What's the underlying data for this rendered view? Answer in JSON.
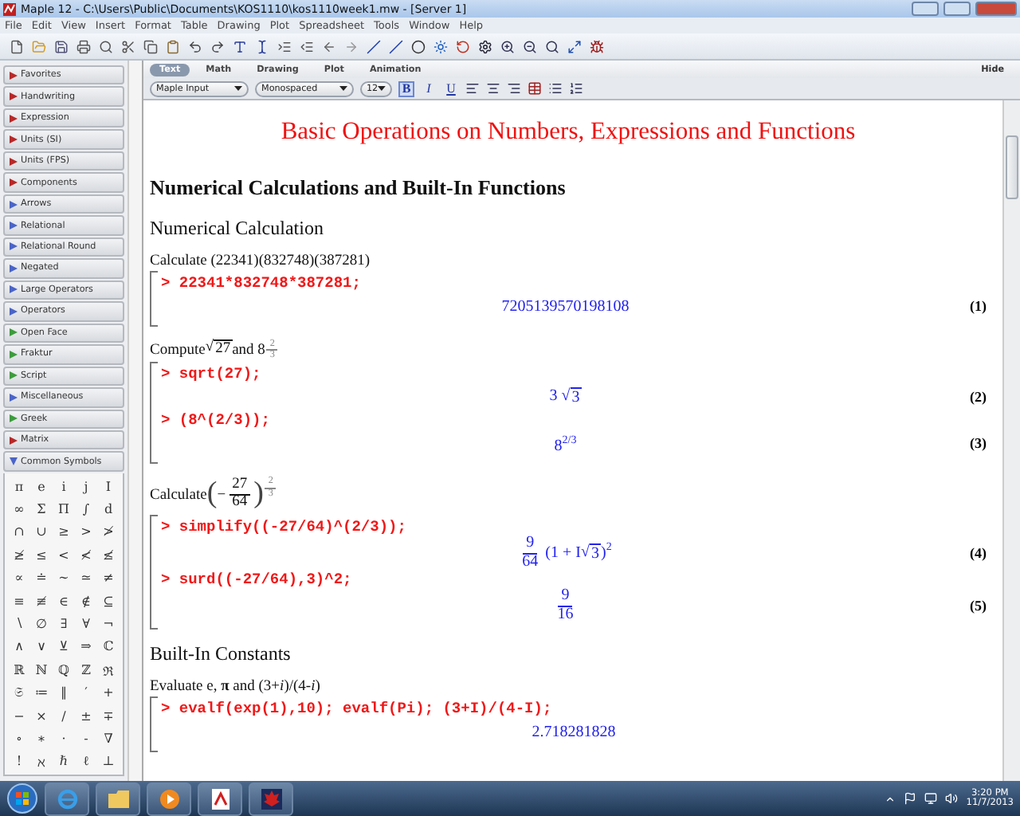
{
  "window": {
    "title": "Maple 12 - C:\\Users\\Public\\Documents\\KOS1110\\kos1110week1.mw - [Server 1]"
  },
  "menu": [
    "File",
    "Edit",
    "View",
    "Insert",
    "Format",
    "Table",
    "Drawing",
    "Plot",
    "Spreadsheet",
    "Tools",
    "Window",
    "Help"
  ],
  "palettes": [
    {
      "label": "Favorites",
      "color": "#b82828",
      "expanded": false
    },
    {
      "label": "Handwriting",
      "color": "#b82828",
      "expanded": false
    },
    {
      "label": "Expression",
      "color": "#b82828",
      "expanded": false
    },
    {
      "label": "Units (SI)",
      "color": "#b82828",
      "expanded": false
    },
    {
      "label": "Units (FPS)",
      "color": "#b82828",
      "expanded": false
    },
    {
      "label": "Components",
      "color": "#b82828",
      "expanded": false
    },
    {
      "label": "Arrows",
      "color": "#4a64c8",
      "expanded": false
    },
    {
      "label": "Relational",
      "color": "#4a64c8",
      "expanded": false
    },
    {
      "label": "Relational Round",
      "color": "#4a64c8",
      "expanded": false
    },
    {
      "label": "Negated",
      "color": "#4a64c8",
      "expanded": false
    },
    {
      "label": "Large Operators",
      "color": "#4a64c8",
      "expanded": false
    },
    {
      "label": "Operators",
      "color": "#4a64c8",
      "expanded": false
    },
    {
      "label": "Open Face",
      "color": "#3c9c3c",
      "expanded": false
    },
    {
      "label": "Fraktur",
      "color": "#3c9c3c",
      "expanded": false
    },
    {
      "label": "Script",
      "color": "#3c9c3c",
      "expanded": false
    },
    {
      "label": "Miscellaneous",
      "color": "#4a64c8",
      "expanded": false
    },
    {
      "label": "Greek",
      "color": "#3c9c3c",
      "expanded": false
    },
    {
      "label": "Matrix",
      "color": "#b82828",
      "expanded": false
    },
    {
      "label": "Common Symbols",
      "color": "#4a64c8",
      "expanded": true,
      "symbols": [
        "π",
        "e",
        "i",
        "j",
        "I",
        "∞",
        "Σ",
        "Π",
        "∫",
        "d",
        "∩",
        "∪",
        "≥",
        ">",
        "≯",
        "≱",
        "≤",
        "<",
        "≮",
        "≰",
        "∝",
        "≐",
        "∼",
        "≃",
        "≠",
        "≡",
        "≢",
        "∈",
        "∉",
        "⊆",
        "∖",
        "∅",
        "∃",
        "∀",
        "¬",
        "∧",
        "∨",
        "⊻",
        "⇒",
        "ℂ",
        "ℝ",
        "ℕ",
        "ℚ",
        "ℤ",
        "ℜ",
        "𝔖",
        "≔",
        "‖",
        "′",
        "+",
        "−",
        "×",
        "/",
        "±",
        "∓",
        "∘",
        "∗",
        "·",
        "-",
        "∇",
        "!",
        "ℵ",
        "ℏ",
        "ℓ",
        "⊥"
      ]
    }
  ],
  "context_tabs": [
    {
      "label": "Text",
      "selected": true
    },
    {
      "label": "Math",
      "selected": false
    },
    {
      "label": "Drawing",
      "selected": false
    },
    {
      "label": "Plot",
      "selected": false
    },
    {
      "label": "Animation",
      "selected": false
    }
  ],
  "hide_button": "Hide",
  "style_dropdown": "Maple Input",
  "font_dropdown": "Monospaced",
  "size_dropdown": "12",
  "format_buttons": [
    {
      "label": "B",
      "selected": true
    },
    {
      "label": "I",
      "selected": false
    },
    {
      "label": "U",
      "selected": false
    }
  ],
  "document": [
    {
      "kind": "title",
      "text": "Basic Operations on Numbers, Expressions and Functions"
    },
    {
      "kind": "heading",
      "text": "Numerical Calculations and Built-In Functions"
    },
    {
      "kind": "subheading",
      "text": "Numerical Calculation"
    },
    {
      "kind": "text",
      "pieces": [
        {
          "kind": "text",
          "text": "Calculate (22341)(832748)(387281)"
        }
      ]
    },
    {
      "kind": "group",
      "items": [
        {
          "prompt": ">",
          "code": "22341*832748*387281;",
          "output": [
            {
              "kind": "text",
              "text": "7205139570198108"
            }
          ],
          "label": "(1)"
        }
      ]
    },
    {
      "kind": "text",
      "pieces": [
        {
          "kind": "text",
          "text": "Compute "
        },
        {
          "kind": "sqrt",
          "sign": "√",
          "text": "27"
        },
        {
          "kind": "text",
          "text": " and 8"
        },
        {
          "kind": "supfrac",
          "num": "2",
          "den": "3"
        }
      ]
    },
    {
      "kind": "group",
      "items": [
        {
          "prompt": ">",
          "code": "sqrt(27);",
          "output": [
            {
              "kind": "text",
              "text": "3 "
            },
            {
              "kind": "sqrt",
              "sign": "√",
              "text": "3"
            }
          ],
          "label": "(2)"
        },
        {
          "prompt": ">",
          "code": "(8^(2/3));",
          "output": [
            {
              "kind": "text",
              "text": "8"
            },
            {
              "kind": "sup",
              "text": "2/3"
            }
          ],
          "label": "(3)"
        }
      ]
    },
    {
      "kind": "text",
      "pieces": [
        {
          "kind": "text",
          "text": "Calculate "
        },
        {
          "kind": "paren",
          "text": "("
        },
        {
          "kind": "text",
          "text": "−"
        },
        {
          "kind": "frac",
          "num": "27",
          "den": "64"
        },
        {
          "kind": "paren",
          "text": ")"
        },
        {
          "kind": "supfrac",
          "num": "2",
          "den": "3"
        }
      ]
    },
    {
      "kind": "group",
      "items": [
        {
          "prompt": ">",
          "code": "simplify((-27/64)^(2/3));",
          "output": [
            {
              "kind": "frac",
              "num": "9",
              "den": "64"
            },
            {
              "kind": "text",
              "text": " (1 + I"
            },
            {
              "kind": "sqrt",
              "sign": "√",
              "text": "3"
            },
            {
              "kind": "text",
              "text": ")"
            },
            {
              "kind": "sup",
              "text": "2"
            }
          ],
          "label": "(4)"
        },
        {
          "prompt": ">",
          "code": "surd((-27/64),3)^2;",
          "output": [
            {
              "kind": "frac",
              "num": "9",
              "den": "16"
            }
          ],
          "label": "(5)"
        }
      ]
    },
    {
      "kind": "subheading",
      "text": "Built-In Constants"
    },
    {
      "kind": "text",
      "pieces": [
        {
          "kind": "text",
          "text": "Evaluate e, **π** and (3+*i*)/(4-*i*)"
        }
      ]
    },
    {
      "kind": "group",
      "items": [
        {
          "prompt": ">",
          "code": "evalf(exp(1),10); evalf(Pi); (3+I)/(4-I);",
          "output": [
            {
              "kind": "text",
              "text": "2.718281828"
            }
          ]
        }
      ]
    }
  ],
  "clock": {
    "time": "3:20 PM",
    "date": "11/7/2013"
  }
}
